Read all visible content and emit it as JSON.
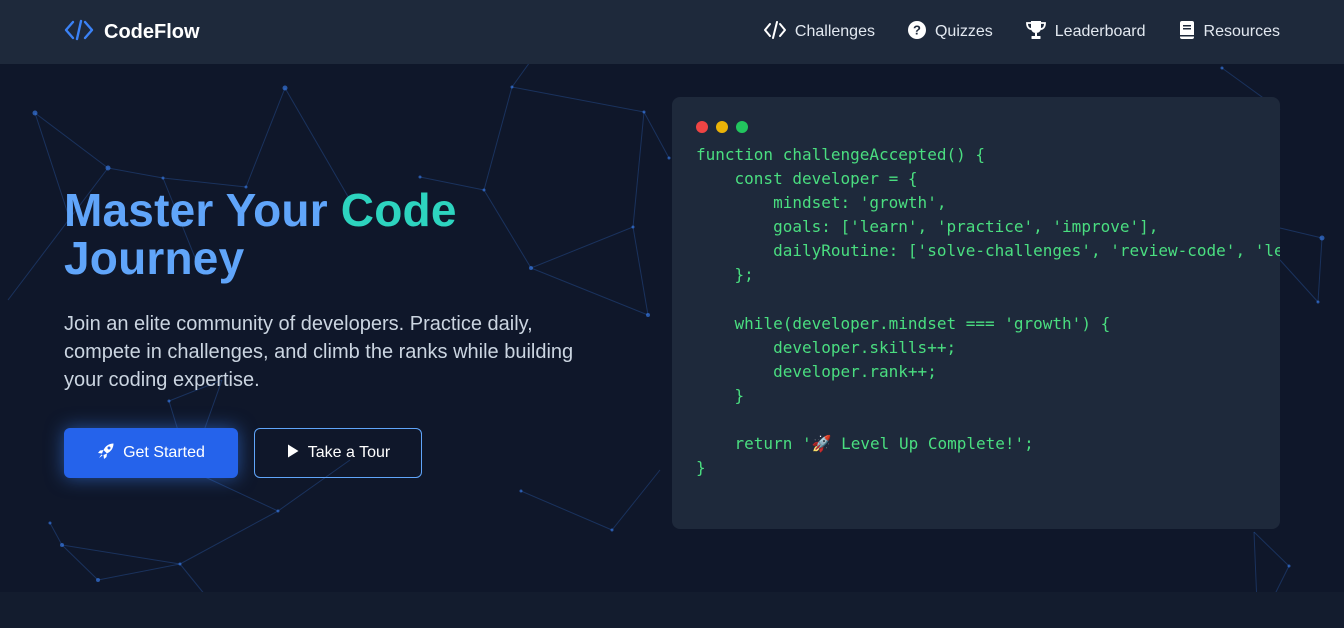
{
  "nav": {
    "brand": "CodeFlow",
    "links": [
      {
        "label": "Challenges",
        "icon": "code-icon"
      },
      {
        "label": "Quizzes",
        "icon": "question-circle-icon"
      },
      {
        "label": "Leaderboard",
        "icon": "trophy-icon"
      },
      {
        "label": "Resources",
        "icon": "book-icon"
      }
    ]
  },
  "hero": {
    "title_part1": "Master Your",
    "title_part2": "Code",
    "title_line2": "Journey",
    "subtitle": "Join an elite community of developers. Practice daily, compete in challenges, and climb the ranks while building your coding expertise.",
    "primary_button": "Get Started",
    "secondary_button": "Take a Tour"
  },
  "code_window": {
    "dot_colors": [
      "#ef4444",
      "#eab308",
      "#22c55e"
    ],
    "lines": [
      "function challengeAccepted() {",
      "    const developer = {",
      "        mindset: 'growth',",
      "        goals: ['learn', 'practice', 'improve'],",
      "        dailyRoutine: ['solve-challenges', 'review-code', 'learn-new'],",
      "    };",
      "",
      "    while(developer.mindset === 'growth') {",
      "        developer.skills++;",
      "        developer.rank++;",
      "    }",
      "",
      "    return '🚀 Level Up Complete!';",
      "}"
    ]
  },
  "colors": {
    "accent_blue": "#2563eb",
    "title_blue": "#60a5fa",
    "title_teal": "#2dd4bf",
    "code_green": "#4ade80",
    "page_bg": "#0f172a",
    "panel_bg": "#1e293b"
  }
}
